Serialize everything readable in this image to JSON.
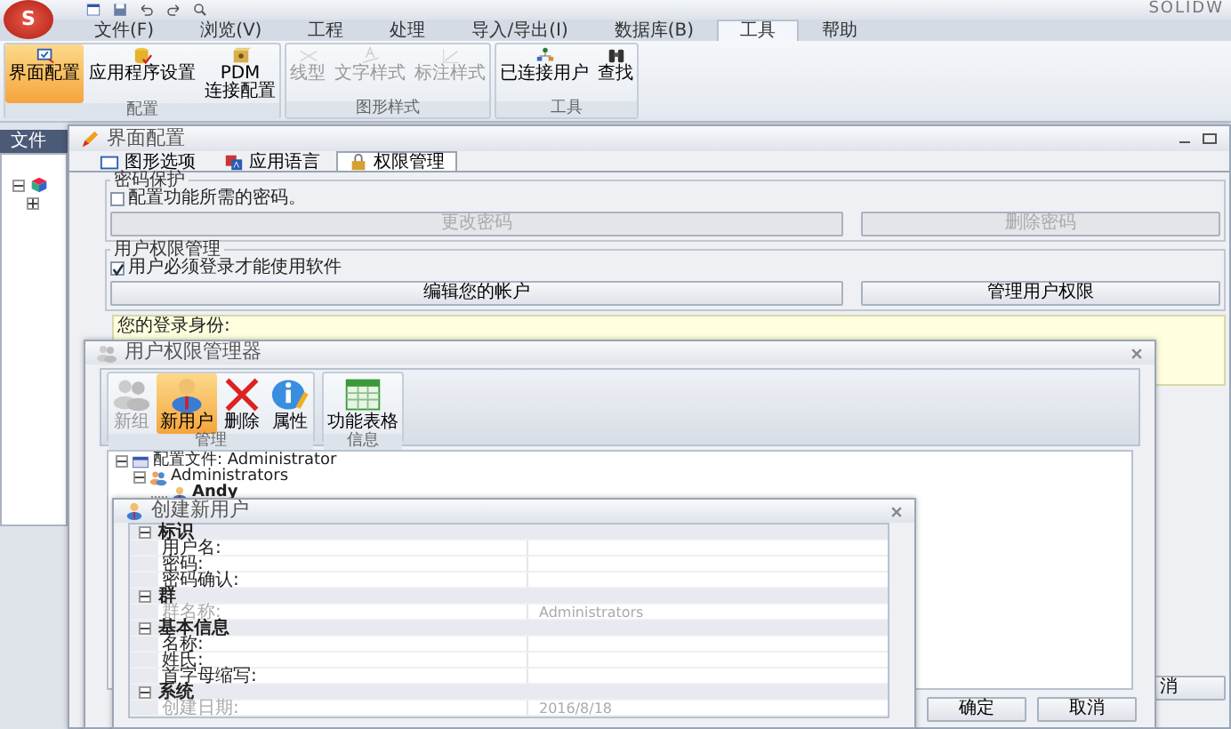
{
  "app": {
    "logo": "S",
    "title": "SOLIDW"
  },
  "menu_tabs": [
    {
      "label": "文件(F)",
      "selected": false
    },
    {
      "label": "浏览(V)",
      "selected": false
    },
    {
      "label": "工程",
      "selected": false
    },
    {
      "label": "处理",
      "selected": false
    },
    {
      "label": "导入/导出(I)",
      "selected": false
    },
    {
      "label": "数据库(B)",
      "selected": false
    },
    {
      "label": "工具",
      "selected": true
    },
    {
      "label": "帮助",
      "selected": false
    }
  ],
  "ribbon": [
    {
      "label": "配置",
      "buttons": [
        {
          "label": "界面配置",
          "selected": true,
          "disabled": false
        },
        {
          "label": "应用程序设置",
          "selected": false,
          "disabled": false
        },
        {
          "label": "PDM\n连接配置",
          "selected": false,
          "disabled": false
        }
      ]
    },
    {
      "label": "图形样式",
      "buttons": [
        {
          "label": "线型",
          "selected": false,
          "disabled": true
        },
        {
          "label": "文字样式",
          "selected": false,
          "disabled": true
        },
        {
          "label": "标注样式",
          "selected": false,
          "disabled": true
        }
      ]
    },
    {
      "label": "工具",
      "buttons": [
        {
          "label": "已连接用户",
          "selected": false,
          "disabled": false
        },
        {
          "label": "查找",
          "selected": false,
          "disabled": false
        }
      ]
    }
  ],
  "side_panel": {
    "tab": "文件"
  },
  "config_window": {
    "title": "界面配置",
    "tabs": [
      {
        "label": "图形选项",
        "selected": false
      },
      {
        "label": "应用语言",
        "selected": false
      },
      {
        "label": "权限管理",
        "selected": true
      }
    ],
    "groups": [
      {
        "title": "密码保护",
        "checkbox": {
          "label": "配置功能所需的密码。",
          "checked": false
        },
        "buttons": [
          {
            "label": "更改密码",
            "disabled": true
          },
          {
            "label": "删除密码",
            "disabled": true
          }
        ]
      },
      {
        "title": "用户权限管理",
        "checkbox": {
          "label": "用户必须登录才能使用软件",
          "checked": true
        },
        "buttons": [
          {
            "label": "编辑您的帐户",
            "disabled": false
          },
          {
            "label": "管理用户权限",
            "disabled": false
          }
        ]
      }
    ],
    "login_box": "您的登录身份:",
    "cancel_button": "消"
  },
  "manager_window": {
    "title": "用户权限管理器",
    "toolbar": [
      {
        "label": "管理",
        "buttons": [
          {
            "label": "新组",
            "selected": false,
            "disabled": true
          },
          {
            "label": "新用户",
            "selected": true,
            "disabled": false
          },
          {
            "label": "删除",
            "selected": false,
            "disabled": false
          },
          {
            "label": "属性",
            "selected": false,
            "disabled": false
          }
        ]
      },
      {
        "label": "信息",
        "buttons": [
          {
            "label": "功能表格",
            "selected": false,
            "disabled": false
          }
        ]
      }
    ],
    "tree": [
      {
        "label": "配置文件: Administrator",
        "kind": "profile",
        "expanded": true,
        "children": [
          {
            "label": "Administrators",
            "kind": "group",
            "expanded": true,
            "children": [
              {
                "label": "Andy",
                "kind": "user"
              }
            ]
          }
        ]
      }
    ],
    "buttons": [
      "确定",
      "取消"
    ]
  },
  "create_window": {
    "title": "创建新用户",
    "sections": [
      {
        "title": "标识",
        "expanded": true,
        "fields": [
          {
            "label": "用户名:",
            "disabled": false
          },
          {
            "label": "密码:",
            "disabled": false
          },
          {
            "label": "密码确认:",
            "disabled": false
          }
        ]
      },
      {
        "title": "群",
        "expanded": true,
        "fields": [
          {
            "label": "群名称:",
            "value": "Administrators",
            "disabled": true
          }
        ]
      },
      {
        "title": "基本信息",
        "expanded": true,
        "fields": [
          {
            "label": "名称:",
            "disabled": false
          },
          {
            "label": "姓氏:",
            "disabled": false
          },
          {
            "label": "首字母缩写:",
            "disabled": false
          }
        ]
      },
      {
        "title": "系统",
        "expanded": true,
        "fields": [
          {
            "label": "创建日期:",
            "value": "2016/8/18",
            "disabled": true
          }
        ]
      }
    ]
  }
}
